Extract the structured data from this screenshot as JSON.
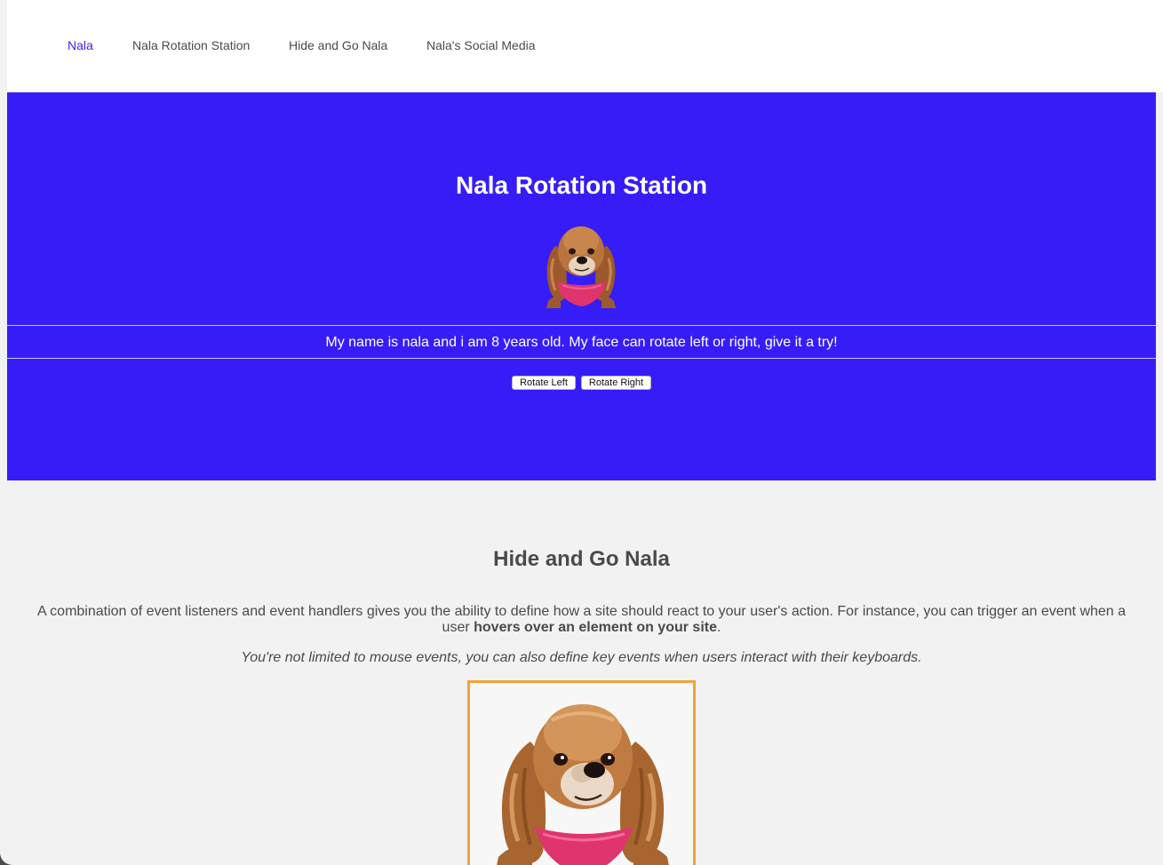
{
  "nav": {
    "items": [
      {
        "label": "Nala",
        "active": true
      },
      {
        "label": "Nala Rotation Station",
        "active": false
      },
      {
        "label": "Hide and Go Nala",
        "active": false
      },
      {
        "label": "Nala's Social Media",
        "active": false
      }
    ]
  },
  "rotation_section": {
    "title": "Nala Rotation Station",
    "description": "My name is nala and i am 8 years old. My face can rotate left or right, give it a try!",
    "rotate_left_label": "Rotate Left",
    "rotate_right_label": "Rotate Right",
    "background_color": "#361df7"
  },
  "hide_section": {
    "title": "Hide and Go Nala",
    "paragraph_prefix": "A combination of event listeners and event handlers gives you the ability to define how a site should react to your user's action. For instance, you can trigger an event when a user ",
    "paragraph_bold": "hovers over an element on your site",
    "paragraph_suffix": ".",
    "italic_note": "You're not limited to mouse events, you can also define key events when users interact with their keyboards.",
    "frame_color": "#f2a23c"
  },
  "colors": {
    "accent": "#3a22f5",
    "text": "#4a4a4a",
    "page_background": "#f2f2f2"
  }
}
